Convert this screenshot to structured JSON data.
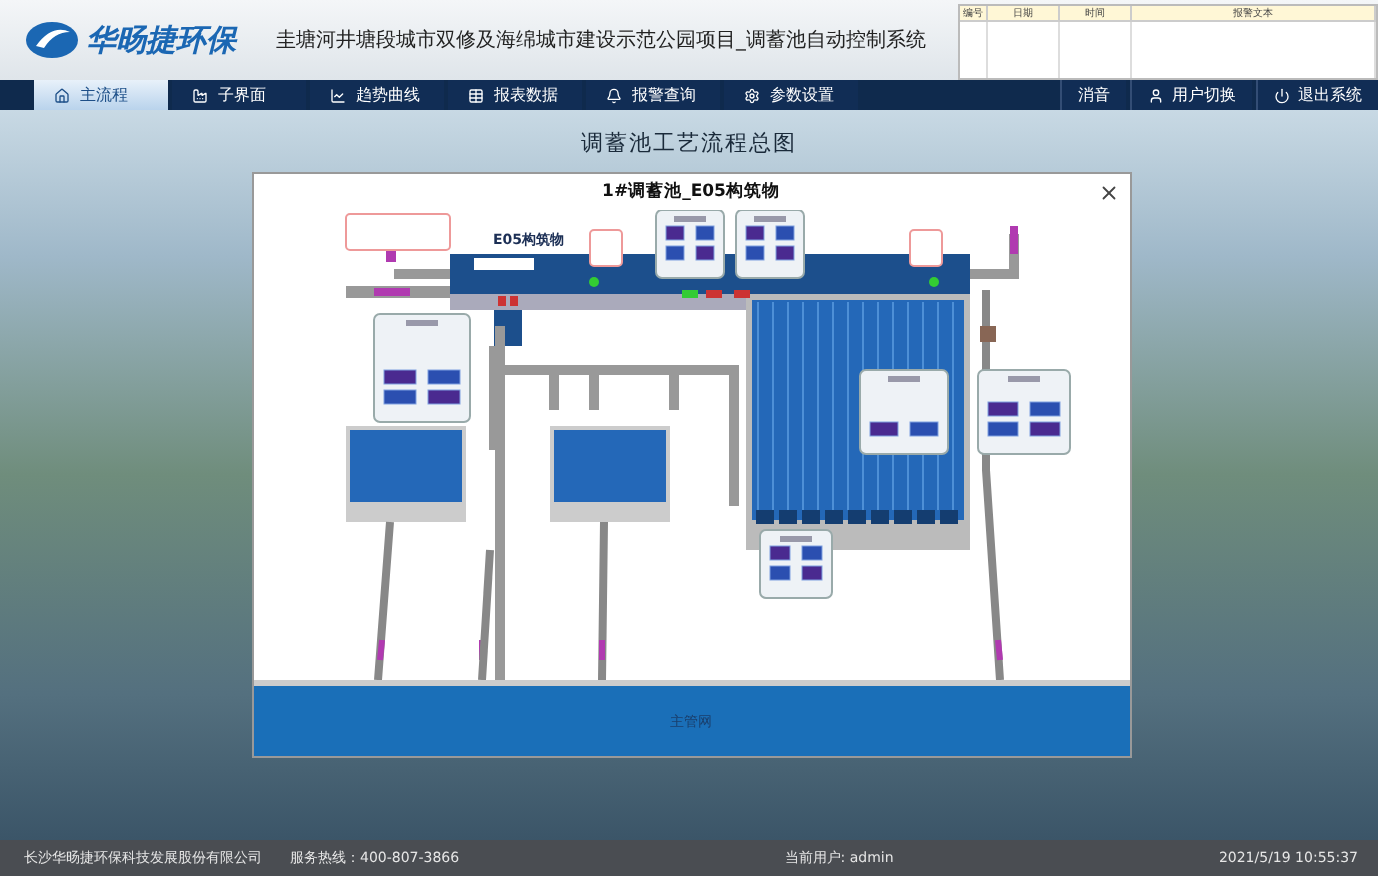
{
  "header": {
    "logo_text": "华旸捷环保",
    "title": "圭塘河井塘段城市双修及海绵城市建设示范公园项目_调蓄池自动控制系统"
  },
  "alarm_table": {
    "columns": [
      "编号",
      "日期",
      "时间",
      "报警文本"
    ]
  },
  "nav": {
    "tabs": [
      {
        "label": "主流程",
        "selected": true
      },
      {
        "label": "子界面",
        "selected": false
      },
      {
        "label": "趋势曲线",
        "selected": false
      },
      {
        "label": "报表数据",
        "selected": false
      },
      {
        "label": "报警查询",
        "selected": false
      },
      {
        "label": "参数设置",
        "selected": false
      }
    ],
    "actions": [
      "消音",
      "用户切换",
      "退出系统"
    ]
  },
  "page_title": "调蓄池工艺流程总图",
  "dialog": {
    "title": "1#调蓄池_E05构筑物",
    "structure_label": "E05构筑物",
    "band_label": "主管网"
  },
  "status_bar": {
    "company": "长沙华旸捷环保科技发展股份有限公司",
    "hotline": "服务热线：400-807-3866",
    "user": "当前用户: admin",
    "datetime": "2021/5/19  10:55:37"
  }
}
